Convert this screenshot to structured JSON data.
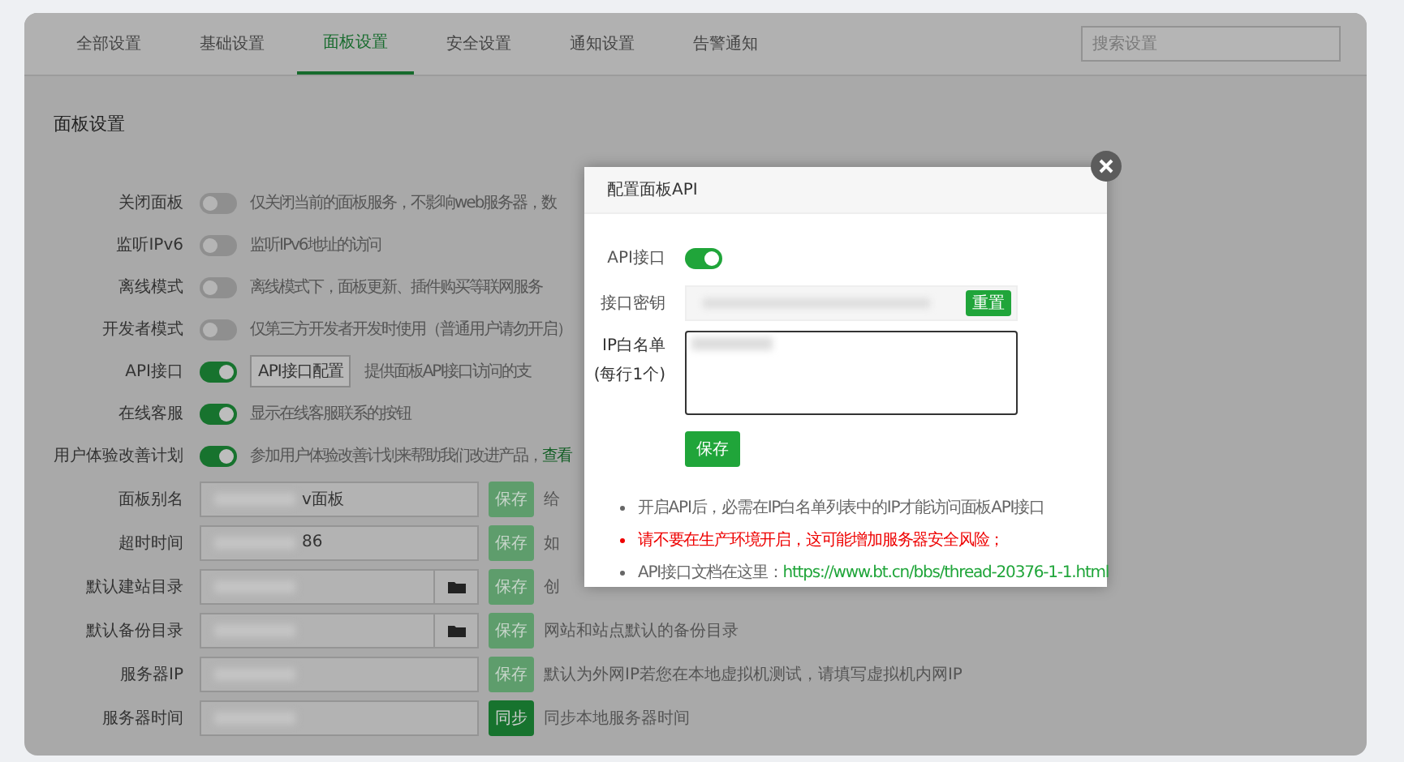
{
  "tabs": [
    {
      "label": "全部设置",
      "selected": false
    },
    {
      "label": "基础设置",
      "selected": false
    },
    {
      "label": "面板设置",
      "selected": true
    },
    {
      "label": "安全设置",
      "selected": false
    },
    {
      "label": "通知设置",
      "selected": false
    },
    {
      "label": "告警通知",
      "selected": false
    }
  ],
  "search": {
    "placeholder": "搜索设置"
  },
  "section_title": "面板设置",
  "switch_rows": [
    {
      "label": "关闭面板",
      "on": false,
      "description": "仅关闭当前的面板服务，不影响web服务器，数"
    },
    {
      "label": "监听IPv6",
      "on": false,
      "description": "监听IPv6地址的访问"
    },
    {
      "label": "离线模式",
      "on": false,
      "description": "离线模式下，面板更新、插件购买等联网服务"
    },
    {
      "label": "开发者模式",
      "on": false,
      "description": "仅第三方开发者开发时使用（普通用户请勿开启）"
    },
    {
      "label": "API接口",
      "on": true,
      "button": "API接口配置",
      "description": "提供面板API接口访问的支"
    },
    {
      "label": "在线客服",
      "on": true,
      "description": "显示在线客服联系的按钮"
    },
    {
      "label": "用户体验改善计划",
      "on": true,
      "description": "参加用户体验改善计划来帮助我们改进产品，",
      "link": "查看"
    }
  ],
  "input_rows": [
    {
      "label": "面板别名",
      "value": "v面板",
      "redacted": true,
      "folder": false,
      "button": "保存",
      "button_active": false,
      "description": "给"
    },
    {
      "label": "超时时间",
      "value": "86",
      "redacted": true,
      "folder": false,
      "button": "保存",
      "button_active": false,
      "description": "如"
    },
    {
      "label": "默认建站目录",
      "redacted": true,
      "folder": true,
      "button": "保存",
      "button_active": false,
      "description": "创"
    },
    {
      "label": "默认备份目录",
      "redacted": true,
      "folder": true,
      "button": "保存",
      "button_active": false,
      "description": "网站和站点默认的备份目录"
    },
    {
      "label": "服务器IP",
      "redacted": true,
      "folder": false,
      "button": "保存",
      "button_active": false,
      "description": "默认为外网IP若您在本地虚拟机测试，请填写虚拟机内网IP"
    },
    {
      "label": "服务器时间",
      "redacted": true,
      "folder": false,
      "button": "同步",
      "button_active": true,
      "description": "同步本地服务器时间"
    }
  ],
  "dialog": {
    "title": "配置面板API",
    "api_label": "API接口",
    "api_on": true,
    "key_label": "接口密钥",
    "key_button": "重置",
    "whitelist_label": "IP白名单",
    "whitelist_hint": "(每行1个)",
    "save": "保存",
    "notes": [
      {
        "kind": "plain",
        "text": "开启API后，必需在IP白名单列表中的IP才能访问面板API接口"
      },
      {
        "kind": "warning",
        "text": "请不要在生产环境开启，这可能增加服务器安全风险；"
      },
      {
        "kind": "link",
        "text": "API接口文档在这里：",
        "link": "https://www.bt.cn/bbs/thread-20376-1-1.html"
      }
    ]
  }
}
